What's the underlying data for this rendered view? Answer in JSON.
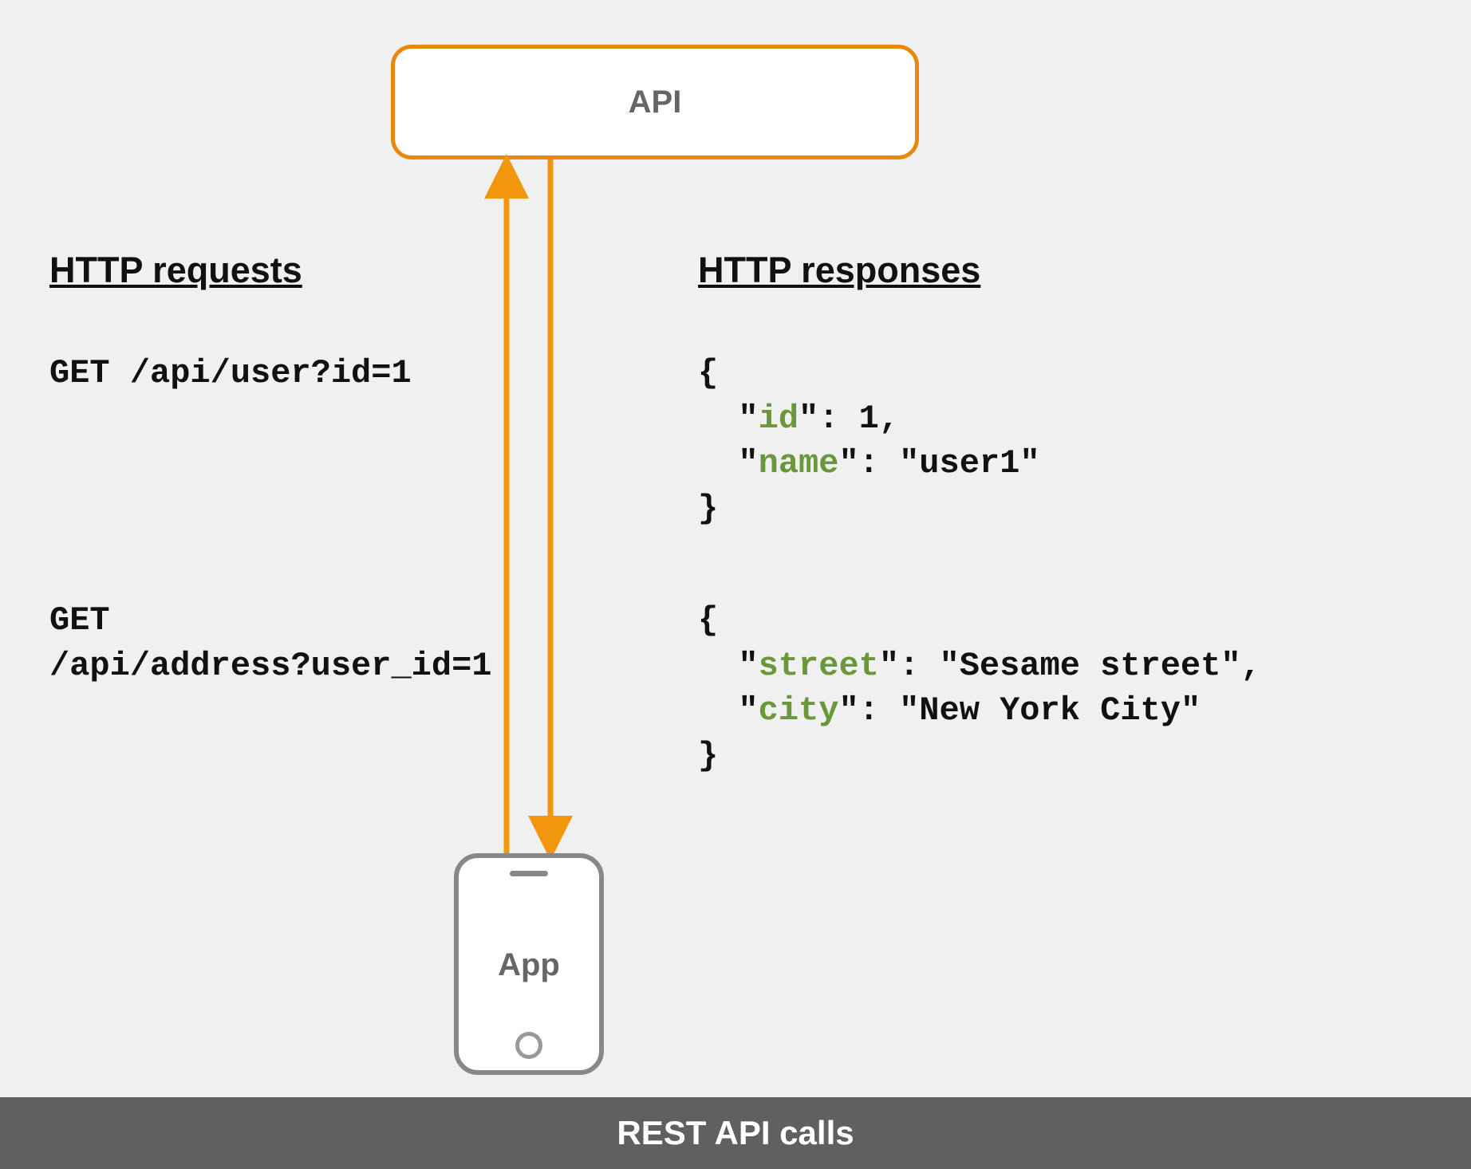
{
  "api_box": {
    "label": "API"
  },
  "phone": {
    "label": "App"
  },
  "headings": {
    "requests": "HTTP requests",
    "responses": "HTTP responses"
  },
  "requests": {
    "req1": "GET /api/user?id=1",
    "req2_line1": "GET",
    "req2_line2": "/api/address?user_id=1"
  },
  "responses": {
    "r1": {
      "open": "{",
      "id_key": "id",
      "id_val": "1",
      "name_key": "name",
      "name_val": "user1",
      "close": "}"
    },
    "r2": {
      "open": "{",
      "street_key": "street",
      "street_val": "Sesame street",
      "city_key": "city",
      "city_val": "New York City",
      "close": "}"
    }
  },
  "footer": "REST API calls",
  "colors": {
    "accent": "#e8890b",
    "json_key": "#6a9739",
    "footer_bg": "#606060"
  }
}
